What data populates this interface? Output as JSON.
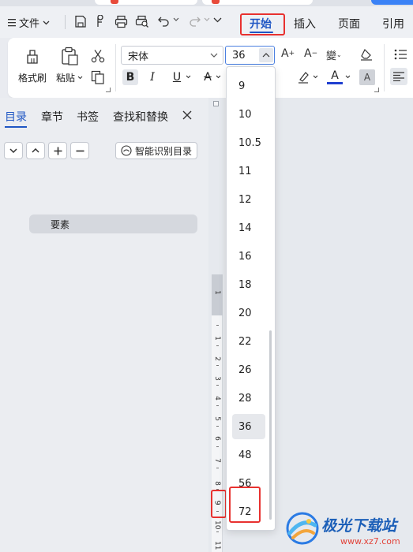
{
  "menu": {
    "file_label": "文件",
    "ribbon_tabs": [
      "开始",
      "插入",
      "页面",
      "引用"
    ],
    "active_tab": "开始"
  },
  "ribbon": {
    "format_painter_label": "格式刷",
    "paste_label": "粘贴",
    "font_name": "宋体",
    "font_size": "36"
  },
  "panel": {
    "tabs": [
      "目录",
      "章节",
      "书签",
      "查找和替换"
    ],
    "active_tab": "目录",
    "smart_toc_label": "智能识别目录",
    "toc_items": [
      "要素"
    ]
  },
  "ruler": {
    "numbers": [
      "1",
      "1",
      "2",
      "3",
      "4",
      "5",
      "6",
      "7",
      "8",
      "9",
      "10",
      "11"
    ]
  },
  "font_size_options": [
    "9",
    "10",
    "10.5",
    "11",
    "12",
    "14",
    "16",
    "18",
    "20",
    "22",
    "26",
    "28",
    "36",
    "48",
    "56",
    "72"
  ],
  "selected_font_size": "36",
  "highlighted_font_size": "72",
  "watermark": {
    "brand_text": "极光下载站",
    "url": "www.xz7.com"
  },
  "colors": {
    "accent": "#1f56c4",
    "highlight_box": "#e8312f",
    "font_color_bar": "#1f3fd0"
  }
}
